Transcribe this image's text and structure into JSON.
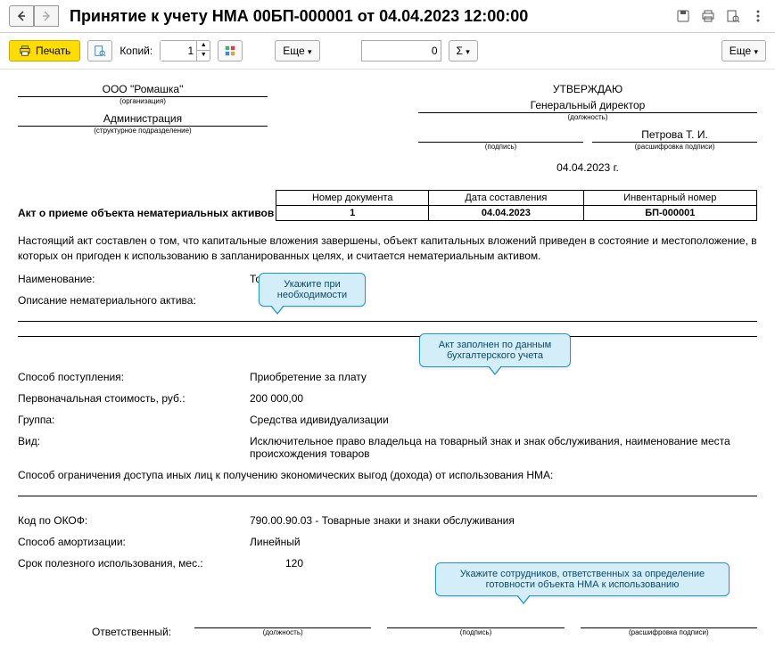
{
  "header": {
    "title": "Принятие к учету НМА 00БП-000001 от 04.04.2023 12:00:00"
  },
  "toolbar": {
    "print_label": "Печать",
    "copies_label": "Копий:",
    "copies_value": "1",
    "eshe_label": "Еще",
    "sum_label": "Σ",
    "num_value": "0"
  },
  "doc": {
    "org": "ООО \"Ромашка\"",
    "org_hint": "(организация)",
    "dept": "Администрация",
    "dept_hint": "(структурное подразделение)",
    "approve": "УТВЕРЖДАЮ",
    "position": "Генеральный директор",
    "position_hint": "(должность)",
    "sign_hint": "(подпись)",
    "signer": "Петрова Т. И.",
    "signer_hint": "(расшифровка подписи)",
    "date": "04.04.2023 г.",
    "act_title": "Акт о приеме объекта нематериальных активов",
    "tbl": {
      "h1": "Номер документа",
      "h2": "Дата составления",
      "h3": "Инвентарный номер",
      "v1": "1",
      "v2": "04.04.2023",
      "v3": "БП-000001"
    },
    "paragraph": "Настоящий акт составлен о том, что капитальные вложения завершены, объект капитальных вложений приведен в состояние и местоположение, в которых он пригоден к использованию в запланированных целях, и считается нематериальным активом.",
    "fields": {
      "name_l": "Наименование:",
      "name_v": "Товарный знак",
      "desc_l": "Описание нематериального актива:",
      "acq_l": "Способ поступления:",
      "acq_v": "Приобретение за плату",
      "cost_l": "Первоначальная стоимость, руб.:",
      "cost_v": "200 000,00",
      "group_l": "Группа:",
      "group_v": "Средства идивидуализации",
      "kind_l": "Вид:",
      "kind_v": "Исключительное право владельца на товарный знак и знак обслуживания, наименование места происхождения товаров",
      "restrict": "Способ ограничения доступа иных лиц к получению экономических выгод (дохода) от использования НМА:",
      "okof_l": "Код по ОКОФ:",
      "okof_v": "790.00.90.03 - Товарные знаки и знаки обслуживания",
      "amort_l": "Способ амортизации:",
      "amort_v": "Линейный",
      "life_l": "Срок полезного использования, мес.:",
      "life_v": "120"
    },
    "responsible": "Ответственный:",
    "resp_hints": {
      "pos": "(должность)",
      "sign": "(подпись)",
      "name": "(расшифровка подписи)"
    }
  },
  "callouts": {
    "c1": "Укажите при необходимости",
    "c2": "Акт заполнен по данным бухгалтерского учета",
    "c3": "Укажите сотрудников, ответственных за определение готовности объекта НМА к использованию"
  }
}
